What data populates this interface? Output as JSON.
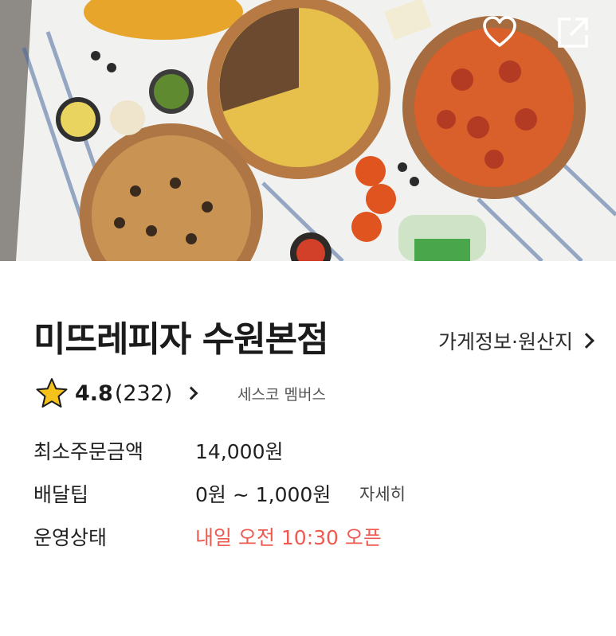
{
  "hero": {
    "image_desc": "pizza-spread-photo",
    "actions": {
      "heart_icon": "heart-icon",
      "share_icon": "external-link-icon"
    }
  },
  "store": {
    "name": "미뜨레피자 수원본점",
    "info_link": "가게정보·원산지",
    "rating": "4.8",
    "review_count": "(232)",
    "membership": "세스코 멤버스"
  },
  "details": {
    "min_order_label": "최소주문금액",
    "min_order_value": "14,000원",
    "delivery_tip_label": "배달팁",
    "delivery_tip_value": "0원 ~ 1,000원",
    "delivery_tip_detail": "자세히",
    "status_label": "운영상태",
    "status_value": "내일 오전 10:30 오픈"
  },
  "colors": {
    "status_red": "#ee5a4f",
    "star_yellow": "#f5c11b"
  }
}
